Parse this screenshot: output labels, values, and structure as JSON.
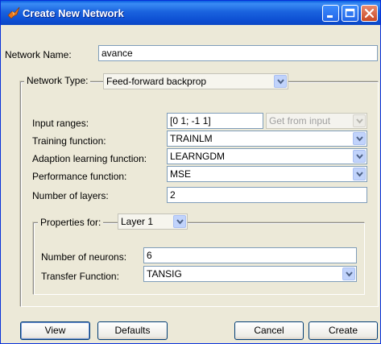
{
  "window": {
    "title": "Create New Network"
  },
  "network_name": {
    "label": "Network Name:",
    "value": "avance"
  },
  "network_type": {
    "label": "Network Type:",
    "value": "Feed-forward backprop"
  },
  "input_ranges": {
    "label": "Input ranges:",
    "value": "[0 1; -1 1]",
    "get_from_input": "Get from input"
  },
  "training_function": {
    "label": "Training function:",
    "value": "TRAINLM"
  },
  "adaption_function": {
    "label": "Adaption learning function:",
    "value": "LEARNGDM"
  },
  "performance_function": {
    "label": "Performance function:",
    "value": "MSE"
  },
  "number_of_layers": {
    "label": "Number of layers:",
    "value": "2"
  },
  "properties": {
    "label": "Properties for:",
    "layer": "Layer 1",
    "neurons_label": "Number of neurons:",
    "neurons_value": "6",
    "transfer_label": "Transfer Function:",
    "transfer_value": "TANSIG"
  },
  "buttons": {
    "view": "View",
    "defaults": "Defaults",
    "cancel": "Cancel",
    "create": "Create"
  },
  "icons": {
    "app": "matlab-logo-icon",
    "dropdown": "chevron-down-icon"
  },
  "colors": {
    "title_bar": "#0a5fe0",
    "window_bg": "#ece9d8",
    "field_border": "#7f9db9"
  }
}
